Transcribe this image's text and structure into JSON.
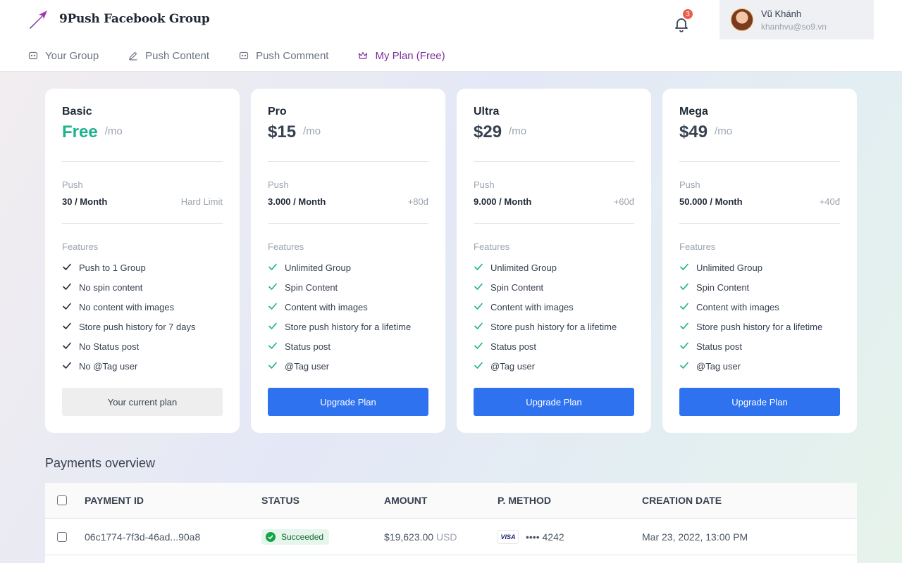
{
  "app": {
    "title": "9Push Facebook Group"
  },
  "notifications": {
    "count": "3"
  },
  "user": {
    "name": "Vũ Khánh",
    "email": "khanhvu@so9.vn"
  },
  "nav": {
    "items": [
      {
        "label": "Your Group",
        "icon": "group-icon"
      },
      {
        "label": "Push Content",
        "icon": "pencil-icon"
      },
      {
        "label": "Push Comment",
        "icon": "comment-icon"
      },
      {
        "label": "My Plan (Free)",
        "icon": "crown-icon",
        "active": true
      }
    ]
  },
  "plans": [
    {
      "name": "Basic",
      "price": "Free",
      "per": "/mo",
      "push_label": "Push",
      "push_value": "30 / Month",
      "push_extra": "Hard Limit",
      "features_label": "Features",
      "features": [
        "Push to 1 Group",
        "No spin content",
        "No content with images",
        "Store push history for 7 days",
        "No Status post",
        "No @Tag user"
      ],
      "button": "Your current plan"
    },
    {
      "name": "Pro",
      "price": "$15",
      "per": "/mo",
      "push_label": "Push",
      "push_value": "3.000 / Month",
      "push_extra": "+80đ",
      "features_label": "Features",
      "features": [
        "Unlimited Group",
        "Spin Content",
        "Content with images",
        "Store push history for a lifetime",
        "Status post",
        "@Tag user"
      ],
      "button": "Upgrade Plan"
    },
    {
      "name": "Ultra",
      "price": "$29",
      "per": "/mo",
      "push_label": "Push",
      "push_value": "9.000 / Month",
      "push_extra": "+60đ",
      "features_label": "Features",
      "features": [
        "Unlimited Group",
        "Spin Content",
        "Content with images",
        "Store push history for a lifetime",
        "Status post",
        "@Tag user"
      ],
      "button": "Upgrade Plan"
    },
    {
      "name": "Mega",
      "price": "$49",
      "per": "/mo",
      "push_label": "Push",
      "push_value": "50.000 / Month",
      "push_extra": "+40đ",
      "features_label": "Features",
      "features": [
        "Unlimited Group",
        "Spin Content",
        "Content with images",
        "Store push history for a lifetime",
        "Status post",
        "@Tag user"
      ],
      "button": "Upgrade Plan"
    }
  ],
  "payments": {
    "title": "Payments overview",
    "columns": [
      "PAYMENT ID",
      "STATUS",
      "AMOUNT",
      "P. METHOD",
      "CREATION DATE"
    ],
    "rows": [
      {
        "id": "06c1774-7f3d-46ad...90a8",
        "status": "Succeeded",
        "amount": "$19,623.00",
        "currency": "USD",
        "card_brand": "VISA",
        "card_number": "•••• 4242",
        "date": "Mar 23, 2022, 13:00 PM"
      }
    ]
  },
  "colors": {
    "accent": "#2f72f0",
    "free": "#1bb28e",
    "nav_active": "#7b2d9a",
    "check_basic": "#1f2937",
    "check_paid": "#1bb28e",
    "badge_red": "#ef5b4b"
  }
}
